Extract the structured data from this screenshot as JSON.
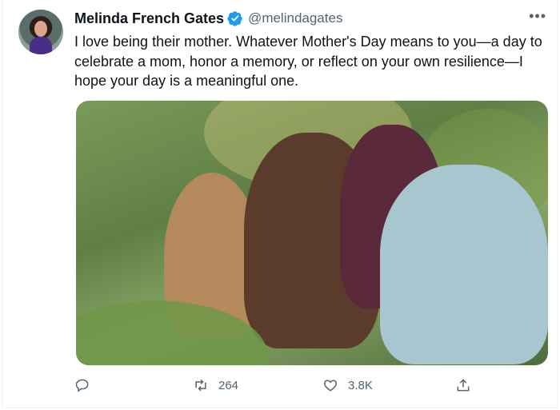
{
  "tweet": {
    "author_name": "Melinda French Gates",
    "handle": "@melindagates",
    "more_label": "•••",
    "text": "I love being their mother. Whatever Mother's Day means to you—a day to celebrate a mom, honor a memory, or reflect on your own resilience—I hope your day is a meaningful one.",
    "photo_icon": "family-photo",
    "accent_color": "#1d9bf0"
  },
  "actions": {
    "reply_icon": "reply-icon",
    "retweet_icon": "retweet-icon",
    "retweet_count": "264",
    "like_icon": "heart-icon",
    "like_count": "3.8K",
    "share_icon": "share-icon"
  }
}
